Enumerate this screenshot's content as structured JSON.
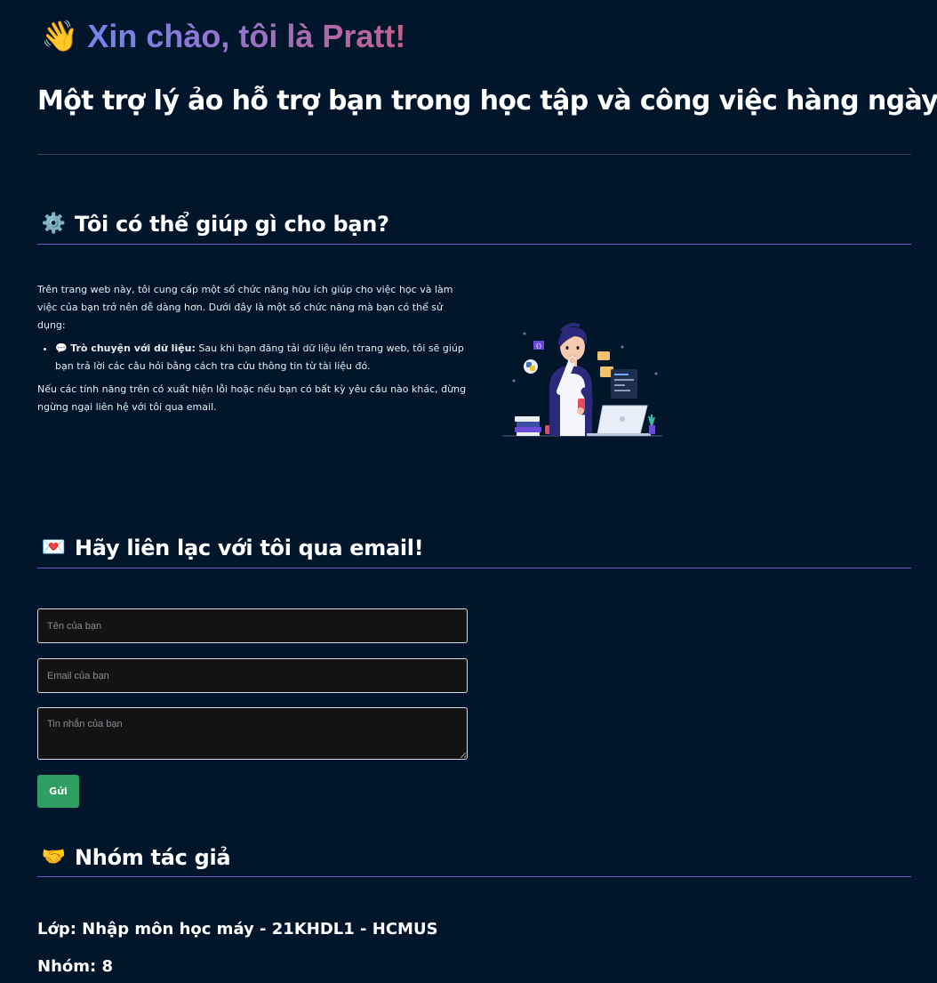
{
  "hero": {
    "icon": "waving-hand-icon",
    "title": "Xin chào, tôi là Pratt!",
    "gradient": [
      "#6e86ee",
      "#9a72c8",
      "#c65f8a"
    ]
  },
  "subtitle": "Một trợ lý ảo hỗ trợ bạn trong học tập và công việc hàng ngày",
  "sections": {
    "help": {
      "icon": "gear-icon",
      "heading": "Tôi có thể giúp gì cho bạn?",
      "intro": "Trên trang web này, tôi cung cấp một số chức năng hữu ích giúp cho việc học và làm việc của bạn trở nên dễ dàng hơn. Dưới đây là một số chức năng mà bạn có thể sử dụng:",
      "features": [
        {
          "icon": "speech-bubble-icon",
          "name": "Trò chuyện với dữ liệu:",
          "description": " Sau khi bạn đăng tải dữ liệu lên trang web, tôi sẽ giúp bạn trả lời các câu hỏi bằng cách tra cứu thông tin từ tài liệu đó."
        }
      ],
      "outro": "Nếu các tính năng trên có xuất hiện lỗi hoặc nếu bạn có bất kỳ yêu cầu nào khác, đừng ngừng ngại liên hệ với tôi qua email."
    },
    "contact": {
      "icon": "love-letter-icon",
      "heading": "Hãy liên lạc với tôi qua email!",
      "name_placeholder": "Tên của bạn",
      "email_placeholder": "Email của bạn",
      "message_placeholder": "Tin nhắn của bạn",
      "send_label": "Gửi"
    },
    "authors": {
      "icon": "handshake-icon",
      "heading": "Nhóm tác giả",
      "class_line": "Lớp: Nhập môn học máy - 21KHDL1 - HCMUS",
      "group_line": "Nhóm: 8"
    }
  },
  "colors": {
    "background": "#01162b",
    "section_rule": "#7a55c9",
    "send_button": "#2f9e63"
  }
}
